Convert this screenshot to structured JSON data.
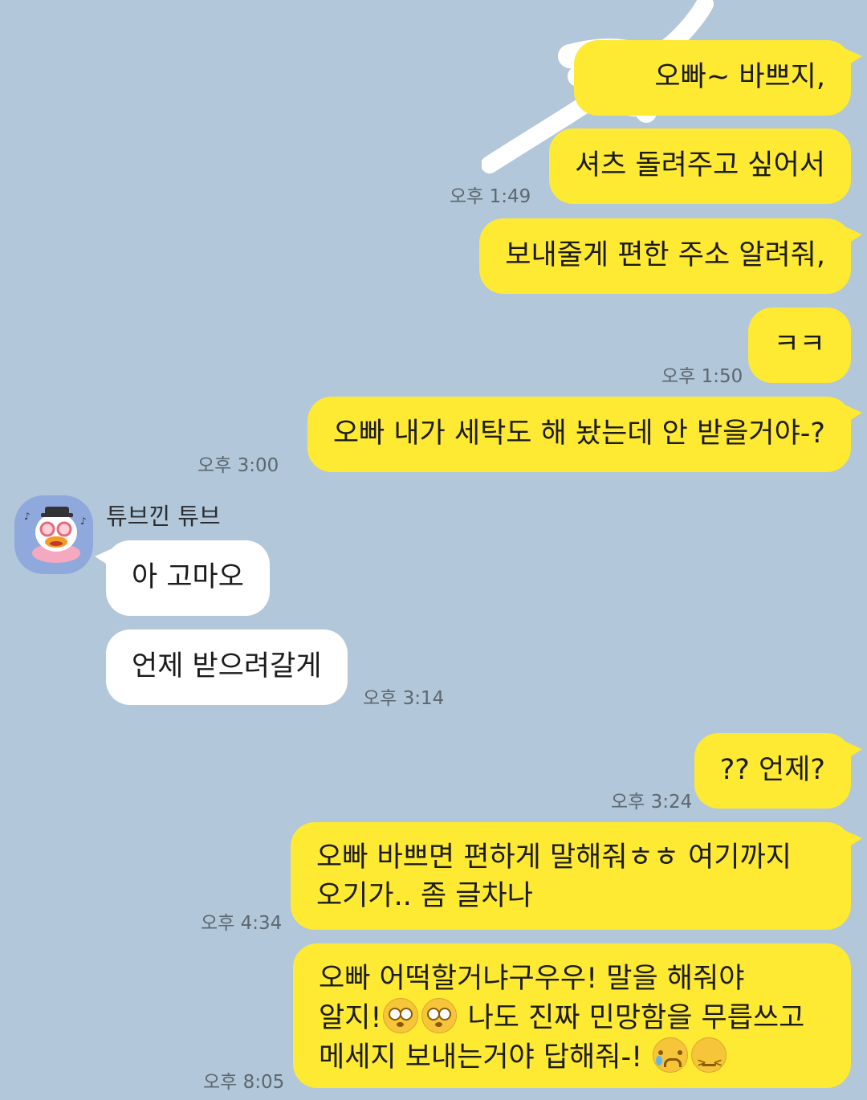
{
  "chat": {
    "sender_name": "튜브낀 튜브",
    "messages": [
      {
        "side": "me",
        "text": "오빠~ 바쁘지,"
      },
      {
        "side": "me",
        "text": "셔츠 돌려주고 싶어서",
        "time": "오후 1:49"
      },
      {
        "side": "me",
        "text": "보내줄게 편한 주소 알려줘,"
      },
      {
        "side": "me",
        "text": "ㅋㅋ",
        "time": "오후 1:50"
      },
      {
        "side": "me",
        "text": "오빠 내가 세탁도 해 놨는데 안 받을거야-?",
        "time": "오후 3:00"
      },
      {
        "side": "other",
        "text": "아 고마오"
      },
      {
        "side": "other",
        "text": "언제 받으려갈게",
        "time": "오후 3:14"
      },
      {
        "side": "me",
        "text": "?? 언제?",
        "time": "오후 3:24"
      },
      {
        "side": "me",
        "line1": "오빠 바쁘면 편하게 말해줘ㅎㅎ 여기까지",
        "line2": "오기가.. 좀 글차나",
        "time": "오후 4:34"
      },
      {
        "side": "me",
        "line1": "오빠 어떡할거냐구우우! 말을 해줘야",
        "line2a": "알지!",
        "line2b": " 나도 진짜 민망함을 무릅쓰고",
        "line3": "메세지 보내는거야 답해줘-! ",
        "time": "오후 8:05"
      }
    ]
  },
  "emoji": {
    "flushed": "flushed-face-icon",
    "sad": "sad-tear-face-icon",
    "squint": "confounded-face-icon"
  },
  "colors": {
    "background": "#b2c7d9",
    "my_bubble": "#fee933",
    "other_bubble": "#ffffff"
  }
}
